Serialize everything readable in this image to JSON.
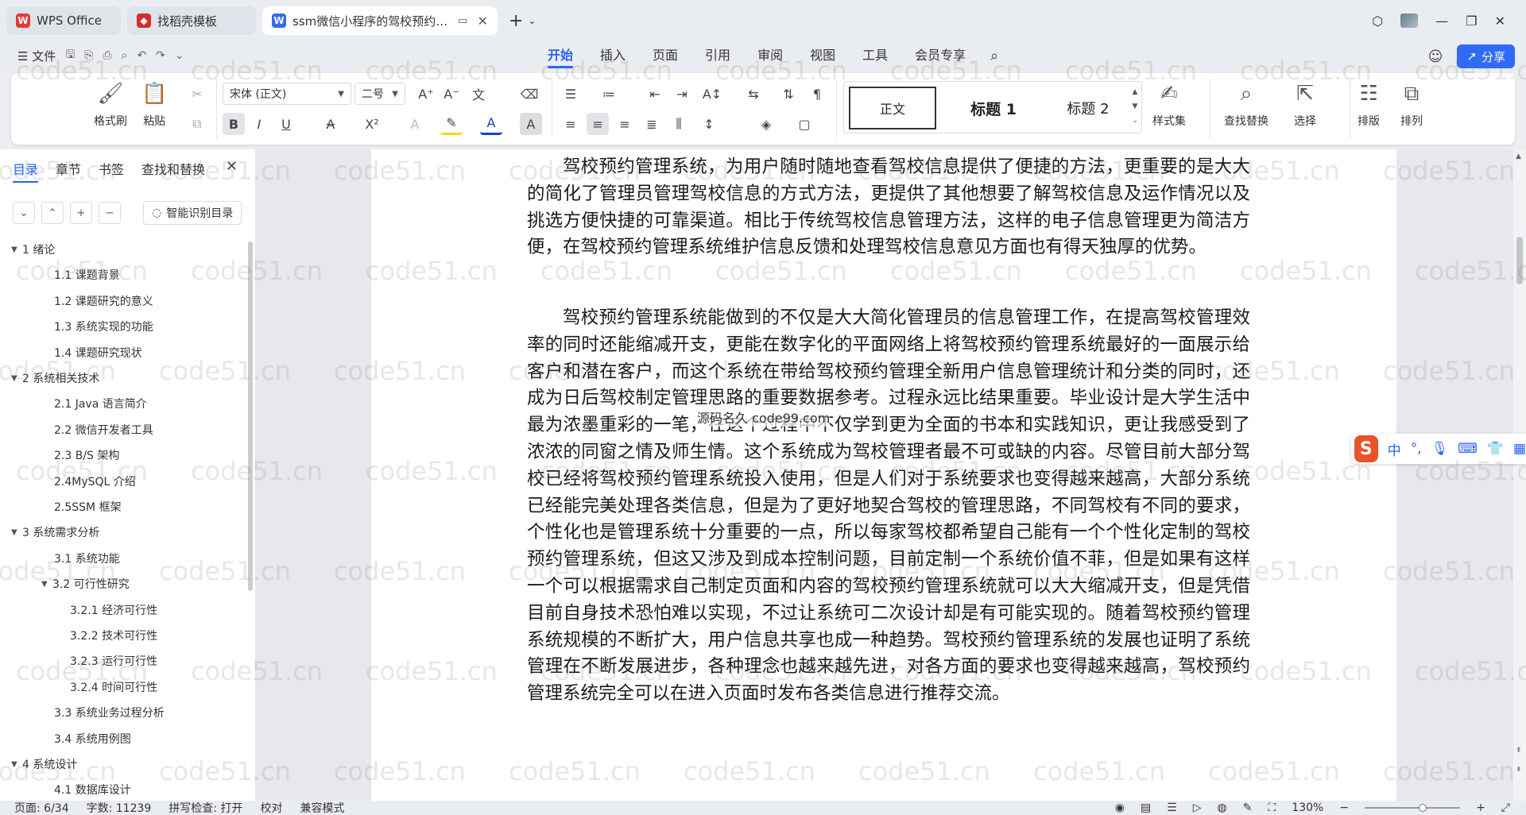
{
  "titlebar": {
    "tabs": [
      {
        "label": "WPS Office",
        "icon": "wps-logo"
      },
      {
        "label": "找稻壳模板",
        "icon": "docer-logo"
      },
      {
        "label": "ssm微信小程序的驾校预约管理系统",
        "icon": "word-doc-icon"
      }
    ],
    "close_glyph": "✕",
    "add_glyph": "+",
    "menu_glyph": "⌄"
  },
  "menubar": {
    "file_label": "文件",
    "tabs": [
      "开始",
      "插入",
      "页面",
      "引用",
      "审阅",
      "视图",
      "工具",
      "会员专享"
    ],
    "share_label": "分享"
  },
  "ribbon": {
    "format_painter": "格式刷",
    "paste": "粘贴",
    "font_name": "宋体 (正文)",
    "font_size": "二号",
    "style_normal": "正文",
    "style_h1": "标题 1",
    "style_h2": "标题 2",
    "style_set": "样式集",
    "find_replace": "查找替换",
    "select": "选择",
    "layout": "排版",
    "arrange": "排列"
  },
  "nav": {
    "tabs": [
      "目录",
      "章节",
      "书签",
      "查找和替换"
    ],
    "smart_toc": "智能识别目录",
    "toc": [
      {
        "label": "1  绪论",
        "level": 1,
        "expanded": true
      },
      {
        "label": "1.1 课题背景",
        "level": 2
      },
      {
        "label": "1.2 课题研究的意义",
        "level": 2
      },
      {
        "label": "1.3  系统实现的功能",
        "level": 2
      },
      {
        "label": "1.4 课题研究现状",
        "level": 2
      },
      {
        "label": "2 系统相关技术",
        "level": 1,
        "expanded": true
      },
      {
        "label": "2.1 Java 语言简介",
        "level": 2
      },
      {
        "label": "2.2 微信开发者工具",
        "level": 2
      },
      {
        "label": "2.3 B/S 架构",
        "level": 2
      },
      {
        "label": "2.4MySQL  介绍",
        "level": 2
      },
      {
        "label": "2.5SSM 框架",
        "level": 2
      },
      {
        "label": "3 系统需求分析",
        "level": 1,
        "expanded": true
      },
      {
        "label": "3.1 系统功能",
        "level": 2
      },
      {
        "label": "3.2 可行性研究",
        "level": 2,
        "expanded": true
      },
      {
        "label": "3.2.1  经济可行性",
        "level": 3
      },
      {
        "label": "3.2.2  技术可行性",
        "level": 3
      },
      {
        "label": "3.2.3  运行可行性",
        "level": 3
      },
      {
        "label": "3.2.4  时间可行性",
        "level": 3
      },
      {
        "label": "3.3 系统业务过程分析",
        "level": 2
      },
      {
        "label": "3.4 系统用例图",
        "level": 2
      },
      {
        "label": "4 系统设计",
        "level": 1,
        "expanded": true
      },
      {
        "label": "4.1 数据库设计",
        "level": 2
      }
    ]
  },
  "document": {
    "paragraphs": [
      "驾校预约管理系统，为用户随时随地查看驾校信息提供了便捷的方法，更重要的是大大的简化了管理员管理驾校信息的方式方法，更提供了其他想要了解驾校信息及运作情况以及挑选方便快捷的可靠渠道。相比于传统驾校信息管理方法，这样的电子信息管理更为简洁方便，在驾校预约管理系统维护信息反馈和处理驾校信息意见方面也有得天独厚的优势。",
      "驾校预约管理系统能做到的不仅是大大简化管理员的信息管理工作，在提高驾校管理效率的同时还能缩减开支，更能在数字化的平面网络上将驾校预约管理系统最好的一面展示给客户和潜在客户，而这个系统在带给驾校预约管理全新用户信息管理统计和分类的同时，还成为日后驾校制定管理思路的重要数据参考。过程永远比结果重要。毕业设计是大学生活中最为浓墨重彩的一笔，在这个过程中不仅学到更为全面的书本和实践知识，更让我感受到了浓浓的同窗之情及师生情。这个系统成为驾校管理者最不可或缺的内容。尽管目前大部分驾校已经将驾校预约管理系统投入使用，但是人们对于系统要求也变得越来越高，大部分系统已经能完美处理各类信息，但是为了更好地契合驾校的管理思路，不同驾校有不同的要求，个性化也是管理系统十分重要的一点，所以每家驾校都希望自己能有一个个性化定制的驾校预约管理系统，但这又涉及到成本控制问题，目前定制一个系统价值不菲，但是如果有这样一个可以根据需求自己制定页面和内容的驾校预约管理系统就可以大大缩减开支，但是凭借目前自身技术恐怕难以实现，不过让系统可二次设计却是有可能实现的。随着驾校预约管理系统规模的不断扩大，用户信息共享也成一种趋势。驾校预约管理系统的发展也证明了系统管理在不断发展进步，各种理念也越来越先进，对各方面的要求也变得越来越高，驾校预约管理系统完全可以在进入页面时发布各类信息进行推荐交流。"
    ],
    "overlay_text": "源码名久 code99.com",
    "watermark": "code51.cn"
  },
  "ime": {
    "logo": "S",
    "mode": "中"
  },
  "statusbar": {
    "page": "页面: 6/34",
    "words": "字数: 11239",
    "spell": "拼写检查: 打开",
    "proofread": "校对",
    "compat": "兼容模式",
    "zoom": "130%"
  }
}
